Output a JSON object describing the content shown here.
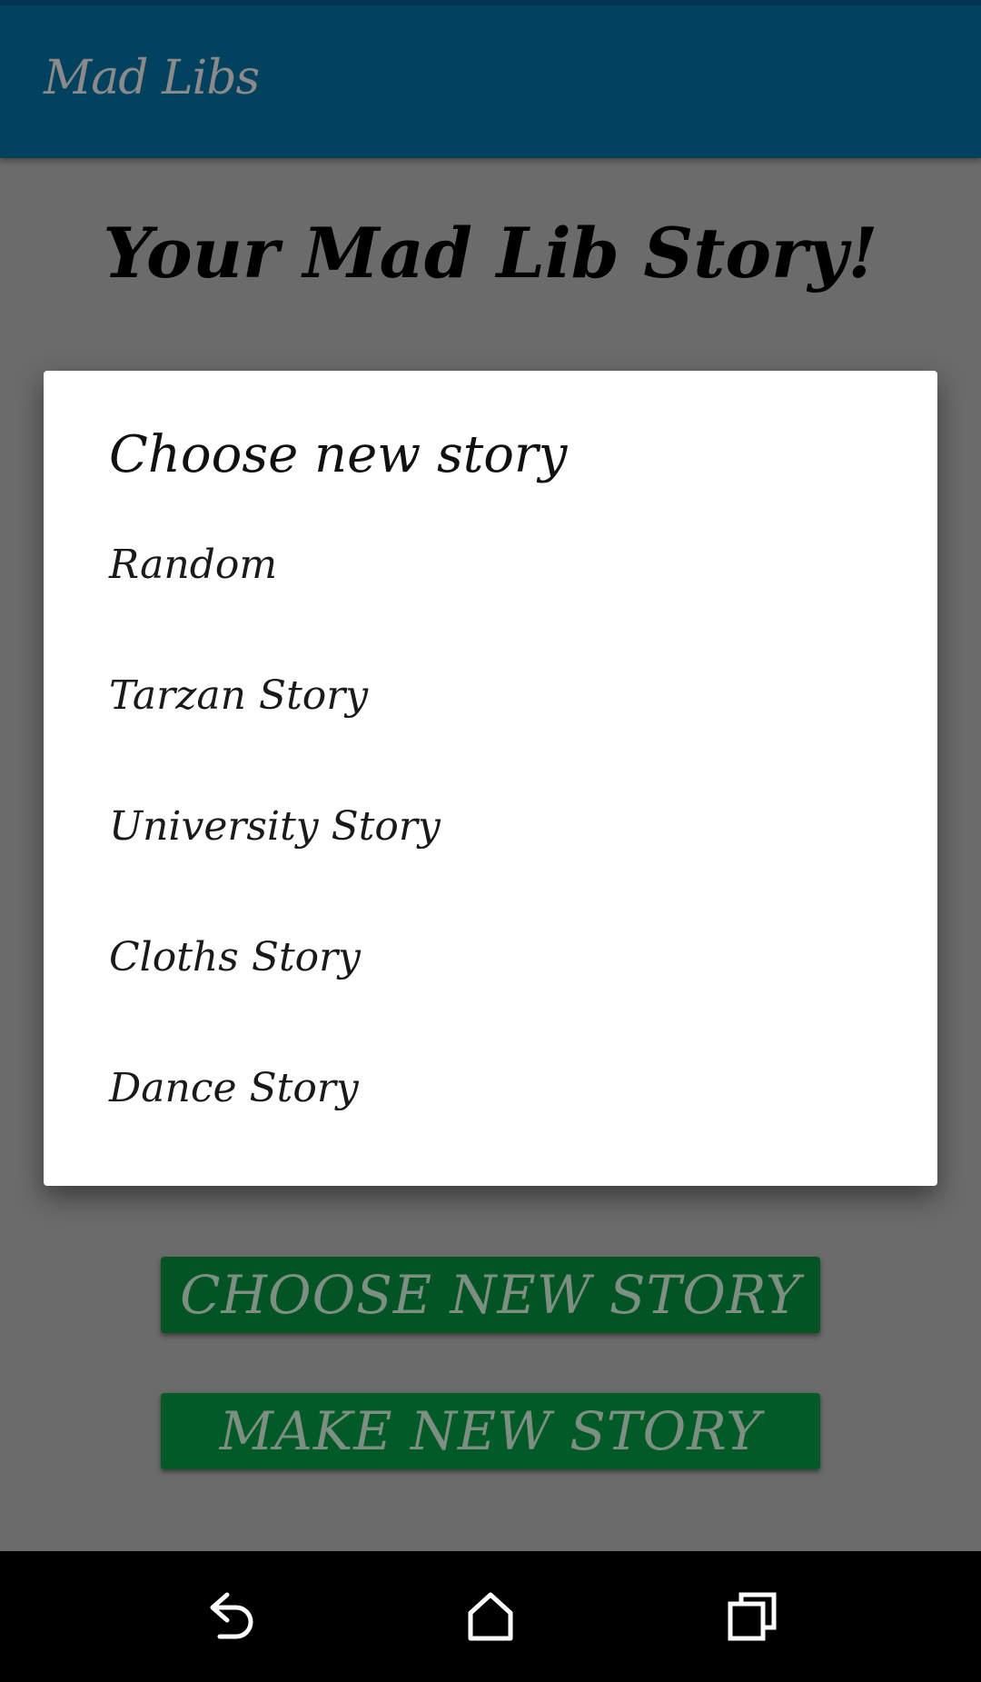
{
  "app_bar": {
    "title": "Mad Libs"
  },
  "main": {
    "heading": "Your Mad Lib Story!",
    "buttons": {
      "choose_new_story": "CHOOSE NEW STORY",
      "make_new_story": "MAKE NEW STORY"
    }
  },
  "dialog": {
    "title": "Choose new story",
    "items": [
      {
        "label": "Random"
      },
      {
        "label": "Tarzan Story"
      },
      {
        "label": "University Story"
      },
      {
        "label": "Cloths Story"
      },
      {
        "label": "Dance Story"
      }
    ]
  },
  "nav_bar": {
    "icons": [
      "back-icon",
      "home-icon",
      "recent-apps-icon"
    ]
  },
  "colors": {
    "app_bar": "#02425f",
    "scrim_background": "#6b6b6b",
    "button_green": "#025425",
    "dialog_bg": "#ffffff"
  }
}
